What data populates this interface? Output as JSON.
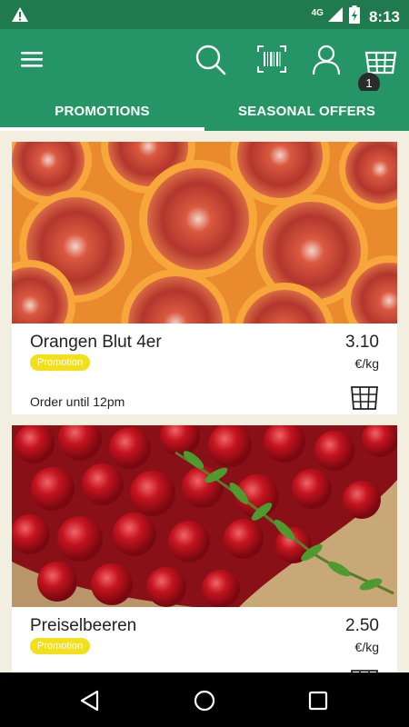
{
  "status_bar": {
    "network": "4G",
    "time": "8:13",
    "icons": [
      "warning-icon",
      "signal-icon",
      "battery-icon"
    ]
  },
  "app_bar": {
    "icons": [
      "menu-icon",
      "search-icon",
      "barcode-icon",
      "account-icon",
      "basket-icon"
    ],
    "basket_count": "1"
  },
  "tabs": [
    {
      "label": "PROMOTIONS",
      "active": true
    },
    {
      "label": "SEASONAL OFFERS",
      "active": false
    }
  ],
  "products": [
    {
      "name": "Orangen Blut 4er",
      "price": "3.10",
      "unit": "€/kg",
      "badge": "Promotion",
      "order_note": "Order until 12pm",
      "image": "blood-orange-image"
    },
    {
      "name": "Preiselbeeren",
      "price": "2.50",
      "unit": "€/kg",
      "badge": "Promotion",
      "order_note": "",
      "image": "cranberries-image"
    }
  ],
  "colors": {
    "primary": "#259565",
    "status_bar": "#1f7a4e",
    "badge": "#f3e01b",
    "background": "#f2efe0"
  }
}
